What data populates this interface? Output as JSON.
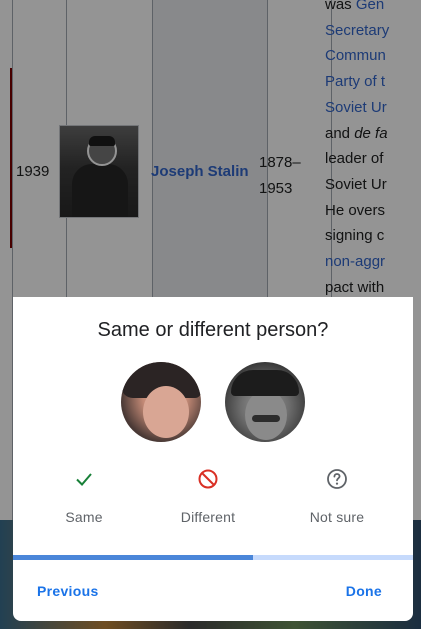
{
  "background_page": {
    "row": {
      "year": "1939",
      "name": "Joseph Stalin",
      "dates": [
        "1878–",
        "1953"
      ],
      "description_lines": [
        {
          "text": "was Gen",
          "parts": [
            {
              "t": "was ",
              "style": "plain"
            },
            {
              "t": "Gen",
              "style": "link"
            }
          ]
        },
        {
          "text": "Secretary",
          "parts": [
            {
              "t": "Secretary",
              "style": "link"
            }
          ]
        },
        {
          "text": "Commun",
          "parts": [
            {
              "t": "Commun",
              "style": "link"
            }
          ]
        },
        {
          "text": "Party of t",
          "parts": [
            {
              "t": "Party of t",
              "style": "link"
            }
          ]
        },
        {
          "text": "Soviet Ur",
          "parts": [
            {
              "t": "Soviet Ur",
              "style": "link"
            }
          ]
        },
        {
          "text": "and de fa",
          "parts": [
            {
              "t": "and ",
              "style": "plain"
            },
            {
              "t": "de fa",
              "style": "italic"
            }
          ]
        },
        {
          "text": "leader of",
          "parts": [
            {
              "t": "leader of",
              "style": "plain"
            }
          ]
        },
        {
          "text": "Soviet Ur",
          "parts": [
            {
              "t": "Soviet Ur",
              "style": "plain"
            }
          ]
        },
        {
          "text": "He overs",
          "parts": [
            {
              "t": "He overs",
              "style": "plain"
            }
          ]
        },
        {
          "text": "signing c",
          "parts": [
            {
              "t": "signing c",
              "style": "plain"
            }
          ]
        },
        {
          "text": "non-aggr",
          "parts": [
            {
              "t": "non-aggr",
              "style": "link"
            }
          ]
        },
        {
          "text": "pact with",
          "parts": [
            {
              "t": "pact with",
              "style": "plain"
            }
          ]
        }
      ]
    }
  },
  "dialog": {
    "title": "Same or different person?",
    "options": {
      "same": {
        "label": "Same",
        "icon": "checkmark-icon",
        "color": "#188038"
      },
      "different": {
        "label": "Different",
        "icon": "block-icon",
        "color": "#d93025"
      },
      "not_sure": {
        "label": "Not sure",
        "icon": "question-circle-icon",
        "color": "#5f6368"
      }
    },
    "progress": 0.6,
    "previous_label": "Previous",
    "done_label": "Done",
    "accent_color": "#1a73e8"
  }
}
